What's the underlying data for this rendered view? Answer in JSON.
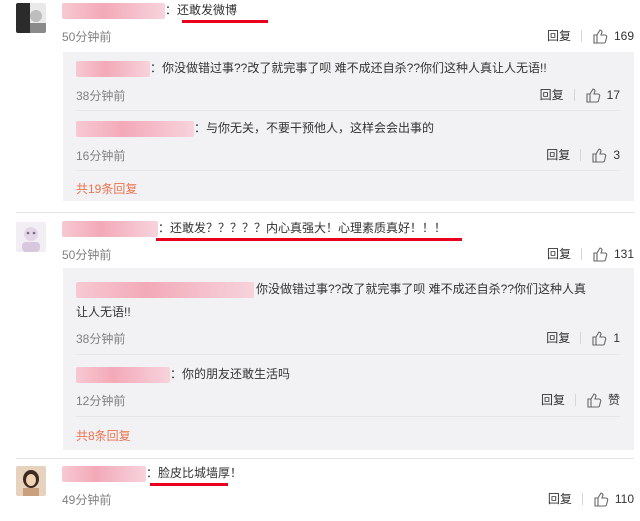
{
  "comments": [
    {
      "text": "：还敢发微博",
      "time": "50分钟前",
      "reply_label": "回复",
      "likes": "169",
      "replies": [
        {
          "text": "：你没做错过事??改了就完事了呗 难不成还自杀??你们这种人真让人无语!!",
          "time": "38分钟前",
          "reply_label": "回复",
          "likes": "17"
        },
        {
          "text": "：与你无关，不要干预他人，这样会会出事的",
          "time": "16分钟前",
          "reply_label": "回复",
          "likes": "3"
        }
      ],
      "more": "共19条回复"
    },
    {
      "text": "：还敢发？？？？？内心真强大！心理素质真好！！！",
      "time": "50分钟前",
      "reply_label": "回复",
      "likes": "131",
      "replies": [
        {
          "text_line1": "你没做错过事??改了就完事了呗 难不成还自杀??你们这种人真",
          "text_line2": "让人无语!!",
          "time": "38分钟前",
          "reply_label": "回复",
          "likes": "1"
        },
        {
          "text": "：你的朋友还敢生活吗",
          "time": "12分钟前",
          "reply_label": "回复",
          "likes": "赞"
        }
      ],
      "more": "共8条回复"
    },
    {
      "text": "：脸皮比城墙厚！",
      "time": "49分钟前",
      "reply_label": "回复",
      "likes": "110"
    }
  ],
  "colors": {
    "link": "#eb7350",
    "underline": "#e8001c",
    "reply_bg": "#f2f2f5"
  },
  "icons": {
    "like": "thumbs-up-icon"
  }
}
